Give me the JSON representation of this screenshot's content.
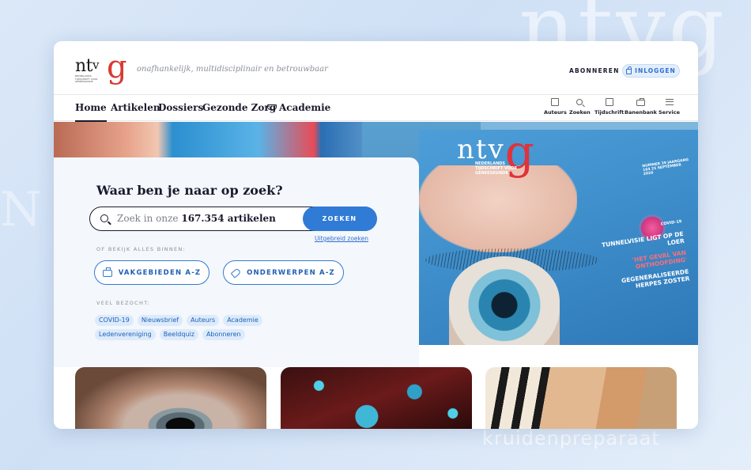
{
  "header": {
    "logo_text": "ntvg",
    "logo_ntv": "nt",
    "logo_v": "v",
    "logo_g": "g",
    "logo_subtext": "NEDERLANDS TIJDSCHRIFT VOOR GENEESKUNDE",
    "tagline": "onafhankelijk, multidisciplinair en betrouwbaar",
    "subscribe_label": "ABONNEREN",
    "login_label": "INLOGGEN"
  },
  "nav": {
    "items": [
      {
        "label": "Home",
        "active": true
      },
      {
        "label": "Artikelen"
      },
      {
        "label": "Dossiers"
      },
      {
        "label": "Gezonde Zorg"
      },
      {
        "label": "Academie"
      }
    ],
    "tools": [
      {
        "label": "Auteurs",
        "icon": "authors-icon"
      },
      {
        "label": "Zoeken",
        "icon": "search-icon"
      },
      {
        "label": "Tijdschrift",
        "icon": "magazine-icon"
      },
      {
        "label": "Banenbank",
        "icon": "briefcase-icon"
      },
      {
        "label": "Service",
        "icon": "menu-icon"
      }
    ]
  },
  "hero": {
    "magazine_title": "ntv",
    "magazine_g": "g",
    "magazine_subtitle": "NEDERLANDS TIJDSCHRIFT VOOR GENEESKUNDE",
    "magazine_issue": "NUMMER 39 JAARGANG 164 25 SEPTEMBER 2020",
    "magazine_badge": "COVID-19",
    "headlines": [
      "TUNNELVISIE LIGT OP DE LOER",
      "'HET GEVAL VAN ONTHOOFDING'",
      "GEGENERALISEERDE HERPES ZOSTER"
    ]
  },
  "search": {
    "heading": "Waar ben je naar op zoek?",
    "placeholder_prefix": "Zoek in onze",
    "placeholder_count": "167.354 artikelen",
    "button_label": "ZOEKEN",
    "advanced_link": "Uitgebreid zoeken",
    "browse_label": "OF BEKIJK ALLES BINNEN:",
    "browse_buttons": [
      "VAKGEBIEDEN A-Z",
      "ONDERWERPEN A-Z"
    ],
    "popular_label": "VEEL BEZOCHT:",
    "popular_tags": [
      "COVID-19",
      "Nieuwsbrief",
      "Auteurs",
      "Academie",
      "Ledenvereniging",
      "Beeldquiz",
      "Abonneren"
    ]
  },
  "background": {
    "word": "kruidenpreparaat",
    "ntvg": "ntvg",
    "letter": "N"
  },
  "colors": {
    "brand_red": "#d93a33",
    "accent_blue": "#2f7bd6",
    "text_dark": "#1a1a2e"
  }
}
